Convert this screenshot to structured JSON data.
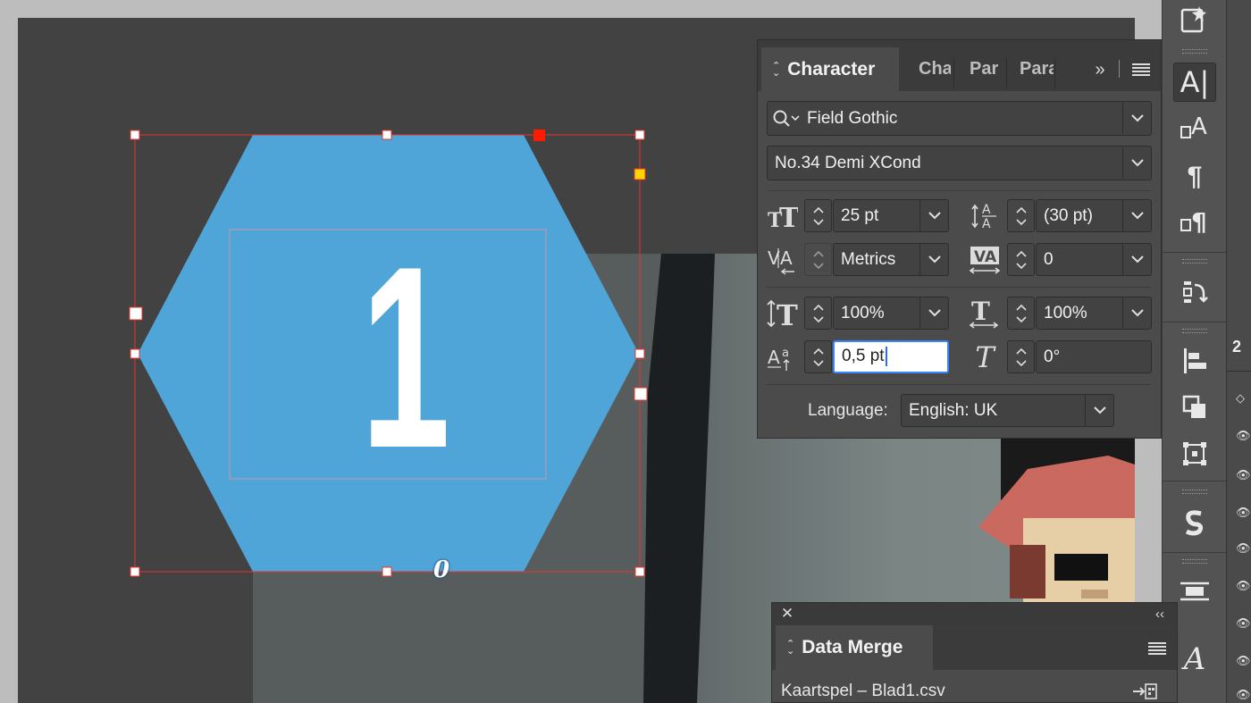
{
  "character_panel": {
    "tabs": {
      "active": "Character",
      "others": [
        "Cha",
        "Par",
        "Para"
      ]
    },
    "font_family": "Field Gothic",
    "font_style": "No.34 Demi XCond",
    "font_size": "25 pt",
    "leading": "(30 pt)",
    "kerning": "Metrics",
    "tracking": "0",
    "vertical_scale": "100%",
    "horizontal_scale": "100%",
    "baseline_shift": "0,5 pt",
    "skew": "0°",
    "language_label": "Language:",
    "language": "English: UK"
  },
  "data_merge_panel": {
    "title": "Data Merge",
    "source_file": "Kaartspel – Blad1.csv"
  },
  "canvas": {
    "hexagon_number": "1",
    "hexagon_color": "#4fa5d8",
    "selection_color": "#e8342c",
    "merge_field_glyph": "0"
  },
  "side_strip": {
    "partial_number": "2"
  },
  "colors": {
    "panel_bg": "#4b4b4b",
    "canvas_bg": "#424242",
    "accent_blue": "#3a84ff"
  }
}
